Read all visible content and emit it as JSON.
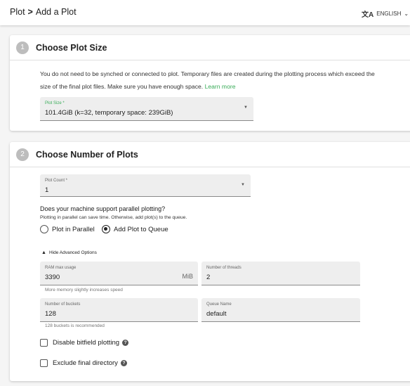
{
  "header": {
    "breadcrumb_root": "Plot",
    "breadcrumb_sep": ">",
    "breadcrumb_current": "Add a Plot",
    "language_icon": "translate-icon",
    "language_label": "ENGLISH"
  },
  "step1": {
    "number": "1",
    "title": "Choose Plot Size",
    "description": "You do not need to be synched or connected to plot. Temporary files are created during the plotting process which exceed the size of the final plot files. Make sure you have enough space.",
    "learn_more": "Learn more",
    "plot_size_label": "Plot Size *",
    "plot_size_value": "101.4GiB (k=32, temporary space: 239GiB)"
  },
  "step2": {
    "number": "2",
    "title": "Choose Number of Plots",
    "plot_count_label": "Plot Count *",
    "plot_count_value": "1",
    "question": "Does your machine support parallel plotting?",
    "question_help": "Plotting in parallel can save time. Otherwise, add plot(s) to the queue.",
    "radio_parallel": "Plot in Parallel",
    "radio_queue": "Add Plot to Queue",
    "selected_mode": "Add Plot to Queue",
    "advanced_toggle": "Hide Advanced Options",
    "ram_label": "RAM max usage",
    "ram_value": "3390",
    "ram_unit": "MiB",
    "ram_helper": "More memory slightly increases speed",
    "threads_label": "Number of threads",
    "threads_value": "2",
    "buckets_label": "Number of buckets",
    "buckets_value": "128",
    "buckets_helper": "128 buckets is recommended",
    "queue_label": "Queue Name",
    "queue_value": "default",
    "disable_bitfield": "Disable bitfield plotting",
    "exclude_final": "Exclude final directory",
    "disable_bitfield_checked": false,
    "exclude_final_checked": false
  },
  "colors": {
    "accent": "#3aac59",
    "field_bg": "#eeeeee"
  }
}
